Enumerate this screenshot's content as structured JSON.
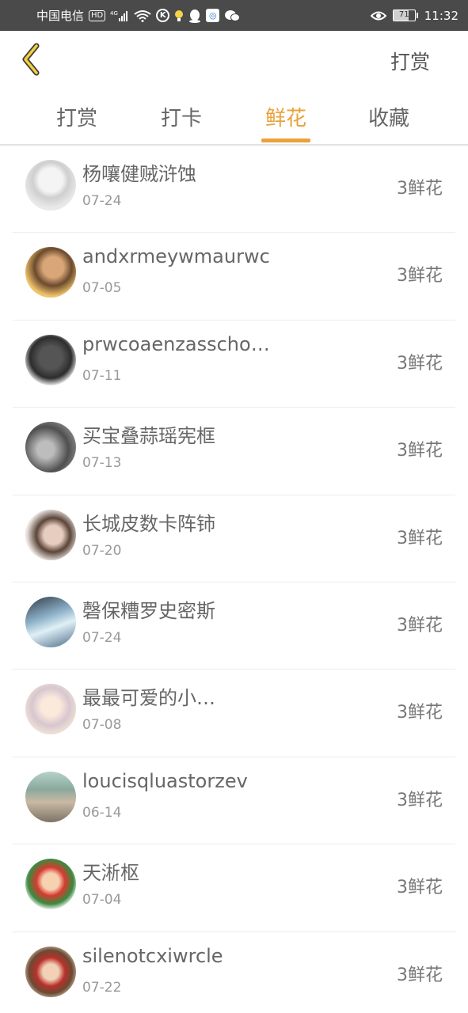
{
  "status_bar": {
    "carrier": "中国电信",
    "hd": "HD",
    "network": "4G",
    "battery": "71",
    "battery_level": 0.71,
    "time": "11:32"
  },
  "header": {
    "back_icon": "chevron-left-icon",
    "action_label": "打赏"
  },
  "tabs": [
    {
      "label": "打赏",
      "active": false
    },
    {
      "label": "打卡",
      "active": false
    },
    {
      "label": "鲜花",
      "active": true
    },
    {
      "label": "收藏",
      "active": false
    }
  ],
  "accent_color": "#e9a23b",
  "list": [
    {
      "name": "杨嚷健贼浒蚀",
      "date": "07-24",
      "count": "3鲜花"
    },
    {
      "name": "andxrmeywmaurwc",
      "date": "07-05",
      "count": "3鲜花"
    },
    {
      "name": "prwcoaenzasscho…",
      "date": "07-11",
      "count": "3鲜花"
    },
    {
      "name": "买宝叠蒜瑶宪框",
      "date": "07-13",
      "count": "3鲜花"
    },
    {
      "name": "长城皮数卡阵铈",
      "date": "07-20",
      "count": "3鲜花"
    },
    {
      "name": "磬保糟罗史密斯",
      "date": "07-24",
      "count": "3鲜花"
    },
    {
      "name": "最最可爱的小…",
      "date": "07-08",
      "count": "3鲜花"
    },
    {
      "name": "loucisqluastorzev",
      "date": "06-14",
      "count": "3鲜花"
    },
    {
      "name": "天淅枢",
      "date": "07-04",
      "count": "3鲜花"
    },
    {
      "name": "silenotcxiwrcle",
      "date": "07-22",
      "count": "3鲜花"
    }
  ]
}
